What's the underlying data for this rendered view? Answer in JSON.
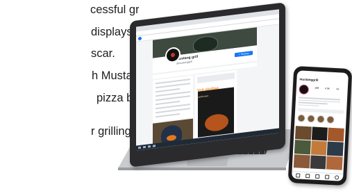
{
  "text_lines": [
    "cessful grilling.",
    "displays.",
    "scar.",
    "h Mustang is",
    "pizza boom",
    "",
    "r grilling."
  ],
  "laptop": {
    "facebook": {
      "page_name": "Mustang grill",
      "page_handle": "@mustanggrill",
      "follow_button": "+ Seuraa",
      "post_title": "Voit aloittaa",
      "post_subline": "nauttimaan"
    }
  },
  "phone": {
    "instagram": {
      "username": "mustanggrill",
      "stats": [
        "189",
        "4 5k",
        "43"
      ]
    }
  },
  "colors": {
    "facebook_blue": "#1877f2",
    "text": "#1d1d1d",
    "laptop_body": "#2b2b2d",
    "phone_body": "#1c1c1e"
  }
}
